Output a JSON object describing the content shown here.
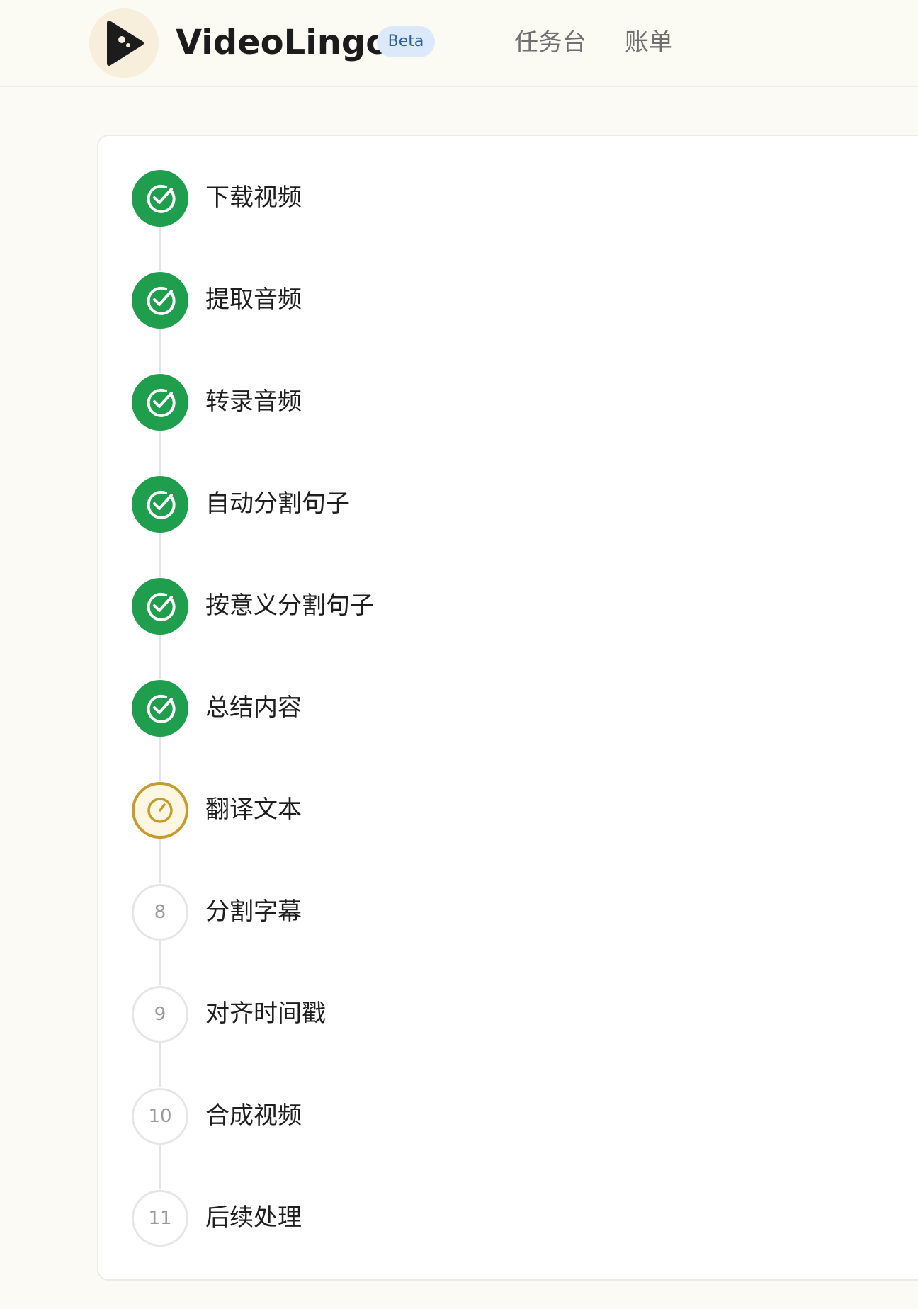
{
  "header": {
    "brand_name": "VideoLingo",
    "badge": "Beta",
    "nav": [
      {
        "label": "任务台"
      },
      {
        "label": "账单"
      }
    ]
  },
  "colors": {
    "done": "#1f9e4e",
    "active": "#c89b2e",
    "pending_border": "#e6e6e6",
    "badge_bg": "#dbe9fb",
    "badge_text": "#2f5ea7"
  },
  "steps": [
    {
      "label": "下载视频",
      "status": "done",
      "icon": "check-circle-icon"
    },
    {
      "label": "提取音频",
      "status": "done",
      "icon": "check-circle-icon"
    },
    {
      "label": "转录音频",
      "status": "done",
      "icon": "check-circle-icon"
    },
    {
      "label": "自动分割句子",
      "status": "done",
      "icon": "check-circle-icon"
    },
    {
      "label": "按意义分割句子",
      "status": "done",
      "icon": "check-circle-icon"
    },
    {
      "label": "总结内容",
      "status": "done",
      "icon": "check-circle-icon"
    },
    {
      "label": "翻译文本",
      "status": "in-progress",
      "icon": "progress-gauge-icon"
    },
    {
      "label": "分割字幕",
      "status": "pending",
      "number": "8"
    },
    {
      "label": "对齐时间戳",
      "status": "pending",
      "number": "9"
    },
    {
      "label": "合成视频",
      "status": "pending",
      "number": "10"
    },
    {
      "label": "后续处理",
      "status": "pending",
      "number": "11"
    }
  ]
}
